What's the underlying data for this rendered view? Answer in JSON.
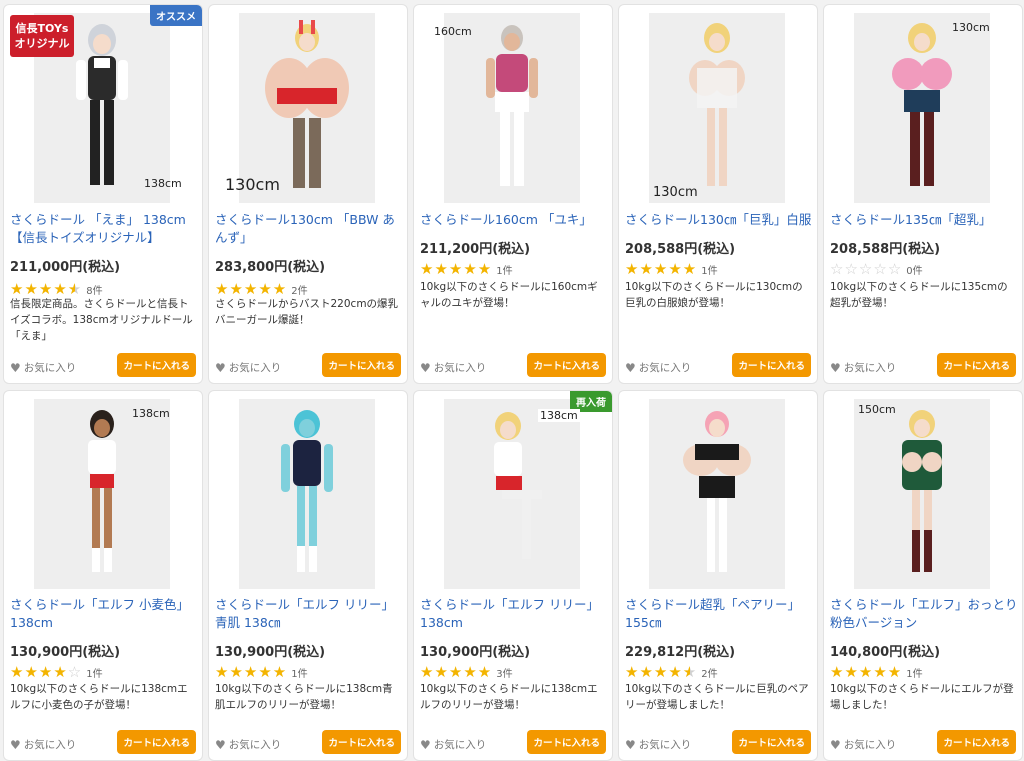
{
  "favorite_label": "お気に入り",
  "cart_label": "カートに入れる",
  "products": [
    {
      "title": "さくらドール 「えま」 138cm【信長トイズオリジナル】",
      "price": "211,000円(税込)",
      "rating": 4.5,
      "review_count": "8件",
      "description": "信長限定商品。さくらドールと信長トイズコラボ。138cmオリジナルドール「えま」",
      "size_label": "138cm",
      "badge": "オススメ",
      "badge_color": "#3a74c5",
      "logo": {
        "line1": "信長TOYs",
        "line2": "オリジナル"
      }
    },
    {
      "title": "さくらドール130cm 「BBW あんず」",
      "price": "283,800円(税込)",
      "rating": 5,
      "review_count": "2件",
      "description": "さくらドールからバスト220cmの爆乳バニーガール爆誕！",
      "size_label": "130cm"
    },
    {
      "title": "さくらドール160cm 「ユキ」",
      "price": "211,200円(税込)",
      "rating": 5,
      "review_count": "1件",
      "description": "10kg以下のさくらドールに160cmギャルのユキが登場！",
      "size_label": "160cm"
    },
    {
      "title": "さくらドール130㎝「巨乳」白服",
      "price": "208,588円(税込)",
      "rating": 5,
      "review_count": "1件",
      "description": "10kg以下のさくらドールに130cmの巨乳の白服娘が登場！",
      "size_label": "130cm"
    },
    {
      "title": "さくらドール135㎝「超乳」",
      "price": "208,588円(税込)",
      "rating": 0,
      "review_count": "0件",
      "description": "10kg以下のさくらドールに135cmの超乳が登場！",
      "size_label": "130cm"
    },
    {
      "title": "さくらドール「エルフ 小麦色」138cm",
      "price": "130,900円(税込)",
      "rating": 4,
      "review_count": "1件",
      "description": "10kg以下のさくらドールに138cmエルフに小麦色の子が登場！",
      "size_label": "138cm"
    },
    {
      "title": "さくらドール「エルフ リリー」青肌 138㎝",
      "price": "130,900円(税込)",
      "rating": 5,
      "review_count": "1件",
      "description": "10kg以下のさくらドールに138cm青肌エルフのリリーが登場！",
      "size_label": ""
    },
    {
      "title": "さくらドール「エルフ リリー」138cm",
      "price": "130,900円(税込)",
      "rating": 5,
      "review_count": "3件",
      "description": "10kg以下のさくらドールに138cmエルフのリリーが登場！",
      "size_label": "138cm",
      "badge": "再入荷",
      "badge_color": "#3a9a2e"
    },
    {
      "title": "さくらドール超乳「ペアリー」155㎝",
      "price": "229,812円(税込)",
      "rating": 4.5,
      "review_count": "2件",
      "description": "10kg以下のさくらドールに巨乳のペアリーが登場しました！",
      "size_label": ""
    },
    {
      "title": "さくらドール「エルフ」おっとり粉色バージョン",
      "price": "140,800円(税込)",
      "rating": 5,
      "review_count": "1件",
      "description": "10kg以下のさくらドールにエルフが登場しました！",
      "size_label": "150cm"
    }
  ]
}
